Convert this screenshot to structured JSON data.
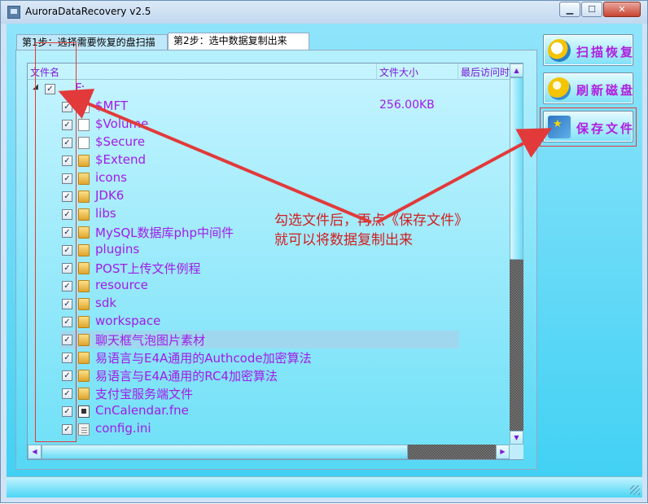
{
  "window": {
    "title": "AuroraDataRecovery v2.5",
    "minimize_glyph": "▁",
    "maximize_glyph": "☐",
    "close_glyph": "✕"
  },
  "tabs": [
    {
      "label": "第1步：选择需要恢复的盘扫描"
    },
    {
      "label": "第2步：选中数据复制出来"
    }
  ],
  "tree": {
    "columns": {
      "name": "文件名",
      "size": "文件大小",
      "last_access": "最后访问时"
    },
    "root": {
      "name": "F:",
      "checked": true,
      "expanded": true
    },
    "items": [
      {
        "name": "$MFT",
        "size": "256.00KB",
        "icon": "file-icon",
        "checked": true
      },
      {
        "name": "$Volume",
        "size": "",
        "icon": "file-icon",
        "checked": true
      },
      {
        "name": "$Secure",
        "size": "",
        "icon": "file-icon",
        "checked": true
      },
      {
        "name": "$Extend",
        "size": "",
        "icon": "folder-icon",
        "checked": true
      },
      {
        "name": "icons",
        "size": "",
        "icon": "folder-icon",
        "checked": true
      },
      {
        "name": "JDK6",
        "size": "",
        "icon": "folder-icon",
        "checked": true
      },
      {
        "name": "libs",
        "size": "",
        "icon": "folder-icon",
        "checked": true
      },
      {
        "name": "MySQL数据库php中间件",
        "size": "",
        "icon": "folder-icon",
        "checked": true
      },
      {
        "name": "plugins",
        "size": "",
        "icon": "folder-icon",
        "checked": true
      },
      {
        "name": "POST上传文件例程",
        "size": "",
        "icon": "folder-icon",
        "checked": true
      },
      {
        "name": "resource",
        "size": "",
        "icon": "folder-icon",
        "checked": true
      },
      {
        "name": "sdk",
        "size": "",
        "icon": "folder-icon",
        "checked": true
      },
      {
        "name": "workspace",
        "size": "",
        "icon": "folder-icon",
        "checked": true
      },
      {
        "name": "聊天框气泡图片素材",
        "size": "",
        "icon": "folder-icon",
        "checked": true,
        "selected": true
      },
      {
        "name": "易语言与E4A通用的Authcode加密算法",
        "size": "",
        "icon": "folder-icon",
        "checked": true
      },
      {
        "name": "易语言与E4A通用的RC4加密算法",
        "size": "",
        "icon": "folder-icon",
        "checked": true
      },
      {
        "name": "支付宝服务端文件",
        "size": "",
        "icon": "folder-icon",
        "checked": true
      },
      {
        "name": "CnCalendar.fne",
        "size": "",
        "icon": "fne-file-icon",
        "checked": true
      },
      {
        "name": "config.ini",
        "size": "",
        "icon": "ini-file-icon",
        "checked": true
      }
    ]
  },
  "buttons": {
    "scan": "扫描恢复",
    "refresh": "刷新磁盘",
    "save": "保存文件"
  },
  "annotation": {
    "line1": "勾选文件后，再点《保存文件》",
    "line2": "就可以将数据复制出来",
    "color": "#e23a3a"
  },
  "colors": {
    "item_text": "#a21bea",
    "header_text": "#7b19d6",
    "client_bg": "#3ed0f3"
  }
}
